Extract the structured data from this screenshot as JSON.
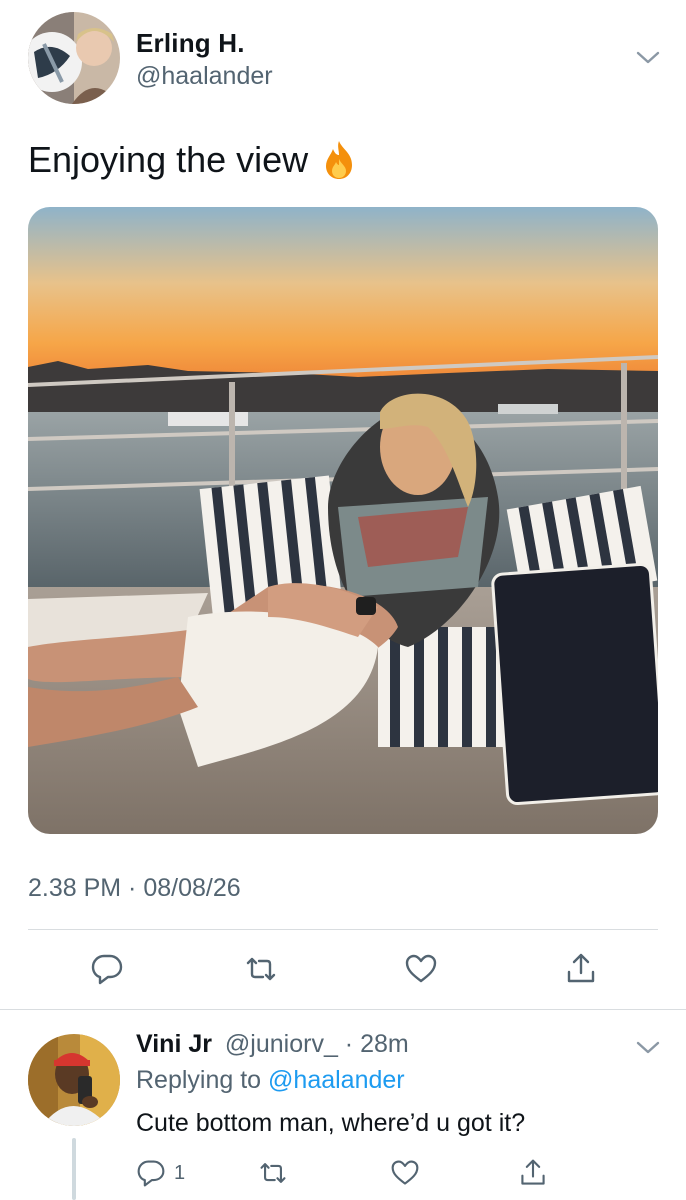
{
  "tweet": {
    "display_name": "Erling H.",
    "handle": "@haalander",
    "text": "Enjoying the view",
    "emoji_icon": "fire-icon",
    "time": "2.38 PM",
    "separator": " · ",
    "date": "08/08/26",
    "media_description": "photo",
    "actions": {
      "reply_icon": "reply-icon",
      "retweet_icon": "retweet-icon",
      "like_icon": "heart-icon",
      "share_icon": "share-icon"
    }
  },
  "reply": {
    "display_name": "Vini Jr",
    "handle": "@juniorv_",
    "separator": " · ",
    "age": "28m",
    "replying_prefix": "Replying to ",
    "replying_to": "@haalander",
    "text": "Cute bottom man, where’d u got it?",
    "reply_count": "1"
  },
  "colors": {
    "text_primary": "#0f1419",
    "text_secondary": "#536471",
    "link": "#1d9bf0",
    "divider": "#d9dde0"
  }
}
